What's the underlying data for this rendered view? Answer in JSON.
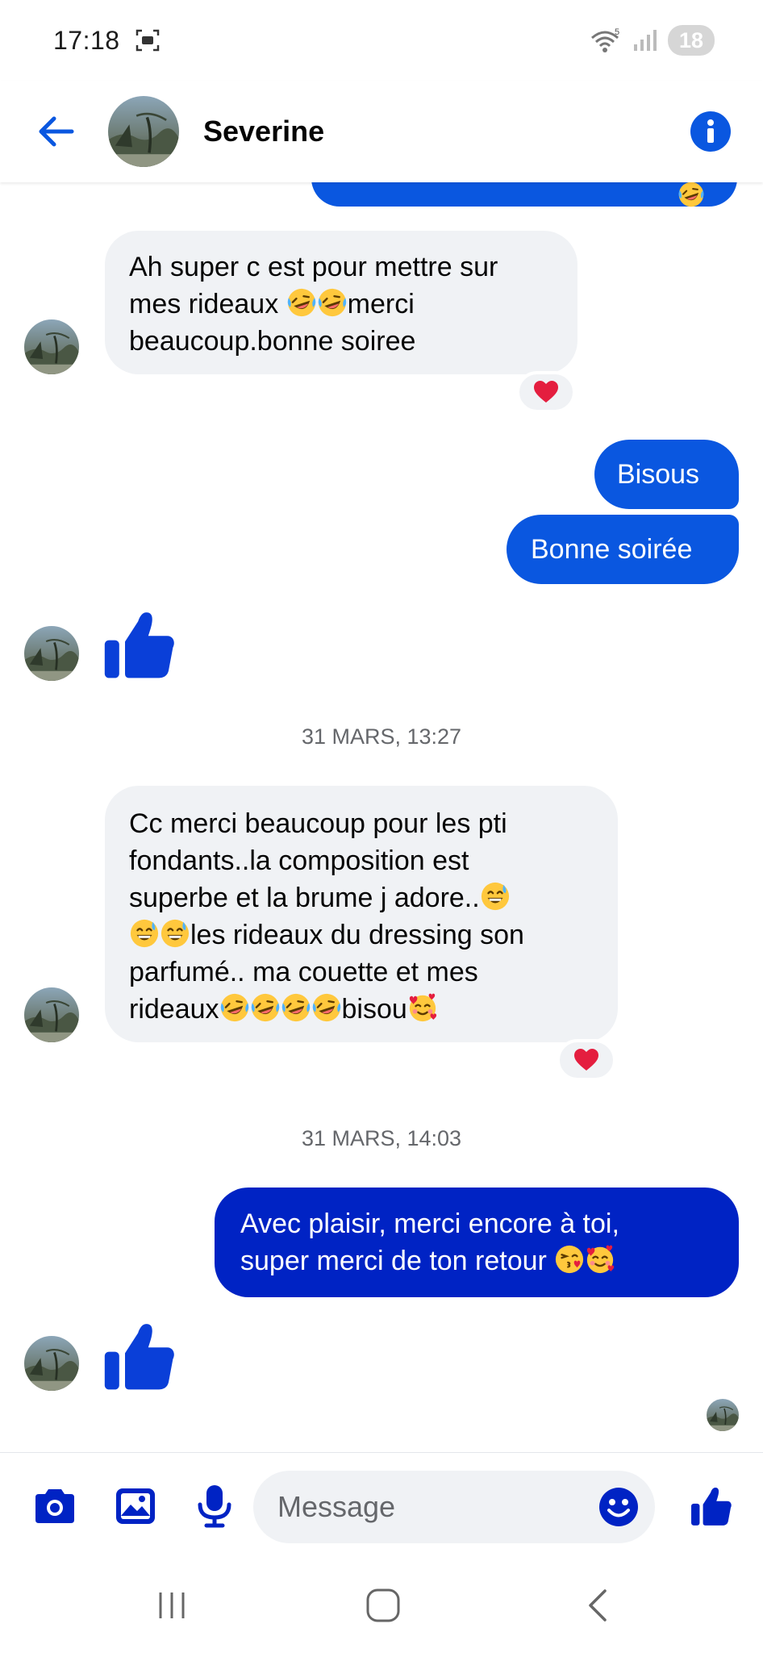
{
  "status_bar": {
    "time": "17:18",
    "battery": "18"
  },
  "header": {
    "contact_name": "Severine"
  },
  "messages": [
    {
      "line1": "Ah super c est pour mettre sur",
      "line2_prefix": "mes rideaux ",
      "line2_suffix": "merci",
      "line3": "beaucoup.bonne soiree"
    },
    {
      "text": "Bisous"
    },
    {
      "text": "Bonne soirée"
    },
    {
      "line1": "Cc merci beaucoup pour les pti",
      "line2": "fondants..la composition est",
      "line3": "superbe et la brume j adore..",
      "line4": "les rideaux du dressing son",
      "line5": "parfumé.. ma couette et mes",
      "line6_prefix": "rideaux",
      "line6_suffix": "bisou"
    },
    {
      "line1": "Avec plaisir, merci encore à toi,",
      "line2": "super merci de ton retour "
    }
  ],
  "timestamps": [
    "31 MARS, 13:27",
    "31 MARS, 14:03"
  ],
  "composer": {
    "placeholder": "Message"
  },
  "icons": [
    "back-arrow-icon",
    "info-icon",
    "heart-icon",
    "thumbs-up-icon",
    "camera-icon",
    "image-icon",
    "microphone-icon",
    "smiley-icon",
    "recents-icon",
    "home-icon",
    "back-icon"
  ],
  "colors": {
    "accent": "#0a57e0",
    "bubble_out_dark": "#0023c4",
    "bubble_in": "#f0f2f5",
    "like": "#0a3fd8",
    "heart": "#e41e3f"
  }
}
